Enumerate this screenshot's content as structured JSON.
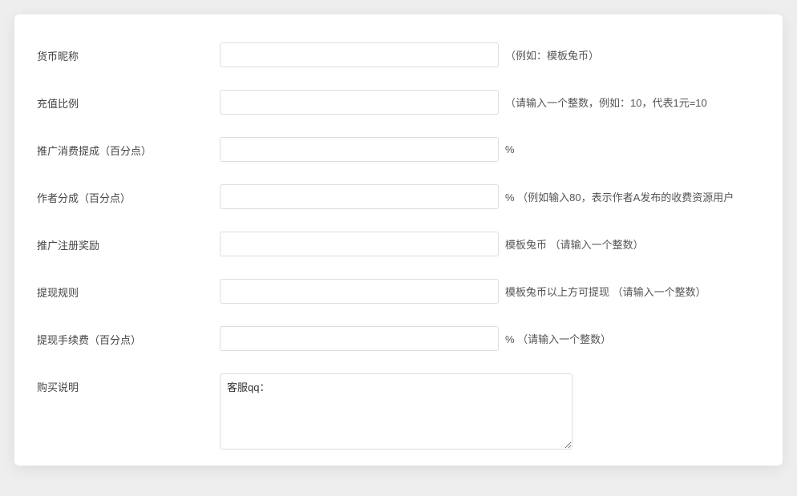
{
  "form": {
    "currency_nickname": {
      "label": "货币昵称",
      "value": "",
      "hint": "（例如：模板兔币）"
    },
    "recharge_ratio": {
      "label": "充值比例",
      "value": "",
      "hint": "（请输入一个整数，例如：10，代表1元=10"
    },
    "promotion_commission": {
      "label": "推广消费提成（百分点）",
      "value": "",
      "hint": "%"
    },
    "author_share": {
      "label": "作者分成（百分点）",
      "value": "",
      "hint": "% （例如输入80，表示作者A发布的收费资源用户"
    },
    "promotion_register_reward": {
      "label": "推广注册奖励",
      "value": "",
      "hint": "模板兔币 （请输入一个整数）"
    },
    "withdraw_rule": {
      "label": "提现规则",
      "value": "",
      "hint": "模板兔币以上方可提现 （请输入一个整数）"
    },
    "withdraw_fee": {
      "label": "提现手续费（百分点）",
      "value": "",
      "hint": "% （请输入一个整数）"
    },
    "purchase_notice": {
      "label": "购买说明",
      "value": "客服qq："
    }
  }
}
